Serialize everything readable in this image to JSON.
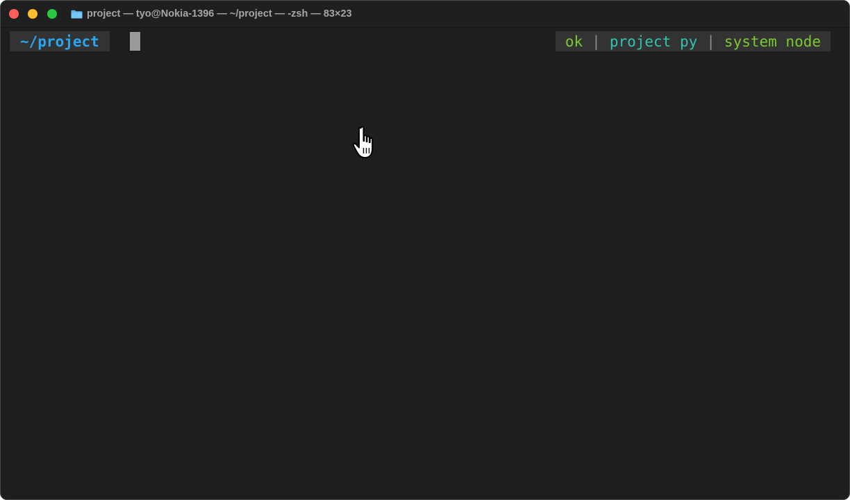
{
  "window": {
    "title": "project — tyo@Nokia-1396 — ~/project — -zsh — 83×23",
    "icon": "folder-icon",
    "controls": [
      "close-button",
      "minimize-button",
      "zoom-button"
    ]
  },
  "terminal": {
    "prompt_path": "~/project",
    "right_prompt": {
      "status": "ok",
      "separator": "|",
      "python_env": "project py",
      "node_env": "system node"
    }
  },
  "colors": {
    "background": "#1e1e1e",
    "prompt_path": "#2aa5f0",
    "status_ok": "#7cc832",
    "python_env": "#33c3b2",
    "node_env": "#7cc832",
    "close": "#fe5f57",
    "minimize": "#febc2e",
    "zoom": "#28c840"
  },
  "pointer": "hand-pointer-icon"
}
